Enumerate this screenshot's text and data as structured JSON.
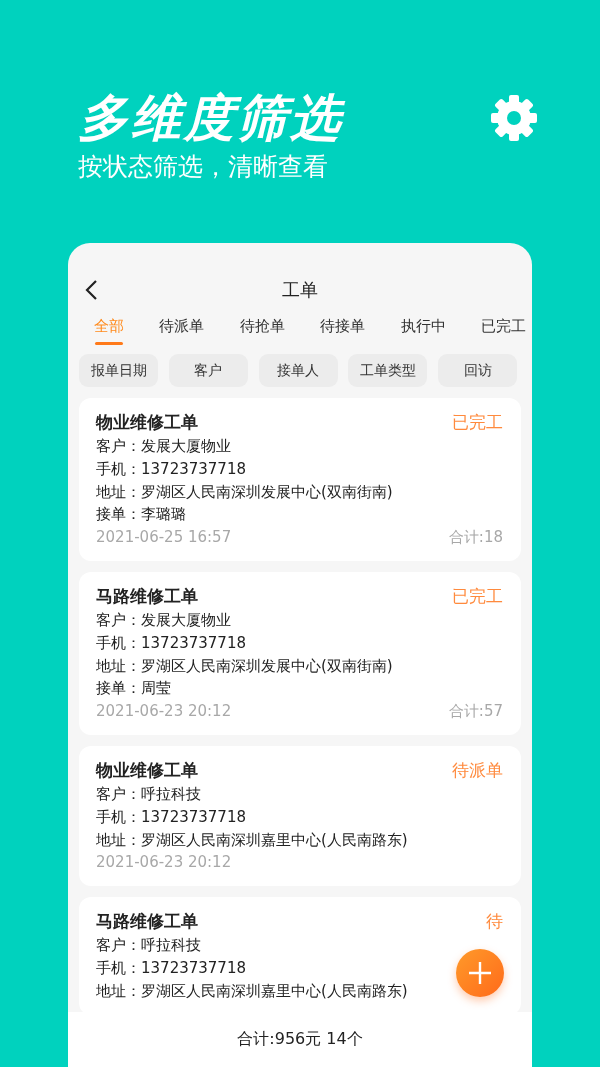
{
  "header": {
    "title": "多维度筛选",
    "subtitle": "按状态筛选，清晰查看"
  },
  "panel": {
    "title": "工单"
  },
  "tabs": [
    {
      "label": "全部",
      "selected": true
    },
    {
      "label": "待派单",
      "selected": false
    },
    {
      "label": "待抢单",
      "selected": false
    },
    {
      "label": "待接单",
      "selected": false
    },
    {
      "label": "执行中",
      "selected": false
    },
    {
      "label": "已完工",
      "selected": false
    }
  ],
  "filters": [
    "报单日期",
    "客户",
    "接单人",
    "工单类型",
    "回访"
  ],
  "orders": [
    {
      "title": "物业维修工单",
      "status": "已完工",
      "lines": [
        {
          "label": "客户：",
          "value": "发展大厦物业"
        },
        {
          "label": "手机：",
          "value": "13723737718"
        },
        {
          "label": "地址：",
          "value": "罗湖区人民南深圳发展中心(双南街南)"
        },
        {
          "label": "接单：",
          "value": "李璐璐"
        }
      ],
      "date": "2021-06-25 16:57",
      "total": "合计:18"
    },
    {
      "title": "马路维修工单",
      "status": "已完工",
      "lines": [
        {
          "label": "客户：",
          "value": "发展大厦物业"
        },
        {
          "label": "手机：",
          "value": "13723737718"
        },
        {
          "label": "地址：",
          "value": "罗湖区人民南深圳发展中心(双南街南)"
        },
        {
          "label": "接单：",
          "value": "周莹"
        }
      ],
      "date": "2021-06-23 20:12",
      "total": "合计:57"
    },
    {
      "title": "物业维修工单",
      "status": "待派单",
      "lines": [
        {
          "label": "客户：",
          "value": "呼拉科技"
        },
        {
          "label": "手机：",
          "value": "13723737718"
        },
        {
          "label": "地址：",
          "value": "罗湖区人民南深圳嘉里中心(人民南路东)"
        }
      ],
      "date": "2021-06-23 20:12"
    },
    {
      "title": "马路维修工单",
      "status": "待",
      "lines": [
        {
          "label": "客户：",
          "value": "呼拉科技"
        },
        {
          "label": "手机：",
          "value": "13723737718"
        },
        {
          "label": "地址：",
          "value": "罗湖区人民南深圳嘉里中心(人民南路东)"
        }
      ]
    }
  ],
  "summary": "合计:956元 14个"
}
